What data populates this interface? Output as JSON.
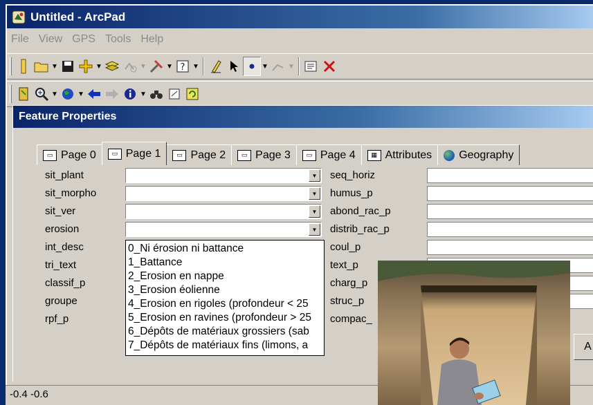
{
  "window": {
    "title": "Untitled - ArcPad"
  },
  "menu": [
    "File",
    "View",
    "GPS",
    "Tools",
    "Help"
  ],
  "dialog": {
    "title": "Feature Properties",
    "tabs": [
      "Page 0",
      "Page 1",
      "Page 2",
      "Page 3",
      "Page 4",
      "Attributes",
      "Geography"
    ],
    "active_tab": "Page 1",
    "left_fields": [
      "sit_plant",
      "sit_morpho",
      "sit_ver",
      "erosion",
      "int_desc",
      "tri_text",
      "classif_p",
      "groupe",
      "rpf_p"
    ],
    "right_fields": [
      "seq_horiz",
      "humus_p",
      "abond_rac_p",
      "distrib_rac_p",
      "coul_p",
      "text_p",
      "charg_p",
      "struc_p",
      "compac_"
    ],
    "erosion_options": [
      "0_Ni érosion ni battance",
      "1_Battance",
      "2_Erosion en nappe",
      "3_Erosion éolienne",
      "4_Erosion en rigoles (profondeur < 25",
      "5_Erosion en ravines (profondeur > 25",
      "6_Dépôts de matériaux grossiers (sab",
      "7_Dépôts de matériaux fins (limons, a"
    ],
    "button_partial": "A"
  },
  "statusbar": {
    "coords": "-0.4 -0.6"
  },
  "icons": {
    "toolbar1": [
      "pencil-icon",
      "open-folder-icon",
      "save-icon",
      "add-layer-icon",
      "layers-icon",
      "gps-icon",
      "tools-icon",
      "help-icon",
      "edit-pen-icon",
      "select-arrow-icon",
      "point-icon",
      "vertex-icon",
      "properties-icon",
      "delete-icon"
    ],
    "toolbar2": [
      "map-icon",
      "zoom-in-icon",
      "globe-icon",
      "back-arrow-icon",
      "forward-arrow-icon",
      "info-icon",
      "find-icon",
      "bookmark-icon",
      "refresh-icon"
    ]
  },
  "colors": {
    "titlebar": "#0a246a",
    "face": "#d4d0c8",
    "desktop": "#0a2a6e"
  }
}
